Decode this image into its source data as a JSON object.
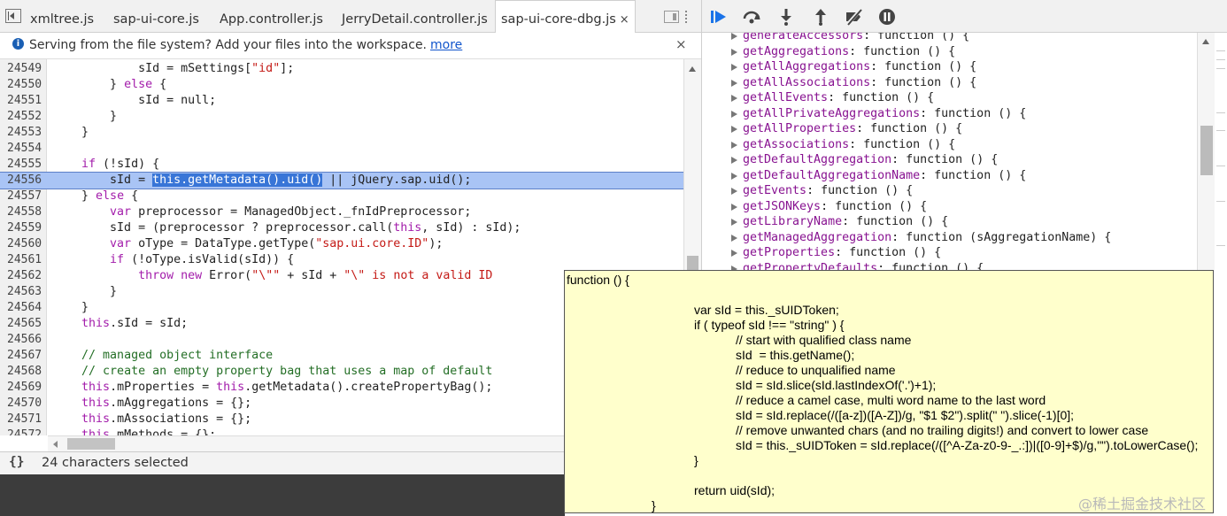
{
  "tabs": [
    {
      "label": "xmltree.js"
    },
    {
      "label": "sap-ui-core.js"
    },
    {
      "label": "App.controller.js"
    },
    {
      "label": "JerryDetail.controller.js"
    },
    {
      "label": "sap-ui-core-dbg.js",
      "active": true,
      "close": "×"
    }
  ],
  "infobar": {
    "message": "Serving from the file system? Add your files into the workspace.",
    "link": "more",
    "close": "×"
  },
  "editor": {
    "lines": [
      {
        "n": "24549",
        "indent": "            ",
        "tokens": [
          [
            "",
            "sId = mSettings["
          ],
          [
            "str",
            "\"id\""
          ],
          [
            "",
            "];"
          ]
        ]
      },
      {
        "n": "24550",
        "indent": "        ",
        "tokens": [
          [
            "",
            "} "
          ],
          [
            "kw",
            "else"
          ],
          [
            "",
            " {"
          ]
        ]
      },
      {
        "n": "24551",
        "indent": "            ",
        "tokens": [
          [
            "",
            "sId = null;"
          ]
        ]
      },
      {
        "n": "24552",
        "indent": "        ",
        "tokens": [
          [
            "",
            "}"
          ]
        ]
      },
      {
        "n": "24553",
        "indent": "    ",
        "tokens": [
          [
            "",
            "}"
          ]
        ]
      },
      {
        "n": "24554",
        "indent": "",
        "tokens": []
      },
      {
        "n": "24555",
        "indent": "    ",
        "tokens": [
          [
            "kw",
            "if"
          ],
          [
            "",
            " (!sId) {"
          ]
        ]
      },
      {
        "n": "24556",
        "indent": "        ",
        "highlight": true,
        "tokens": [
          [
            "",
            "sId = "
          ],
          [
            "sel",
            "this.getMetadata().uid()"
          ],
          [
            "",
            " || jQuery.sap.uid();"
          ]
        ]
      },
      {
        "n": "24557",
        "indent": "    ",
        "tokens": [
          [
            "",
            "} "
          ],
          [
            "kw",
            "else"
          ],
          [
            "",
            " {"
          ]
        ]
      },
      {
        "n": "24558",
        "indent": "        ",
        "tokens": [
          [
            "kw",
            "var"
          ],
          [
            "",
            " preprocessor = ManagedObject._fnIdPreprocessor;"
          ]
        ]
      },
      {
        "n": "24559",
        "indent": "        ",
        "tokens": [
          [
            "",
            "sId = (preprocessor ? preprocessor.call("
          ],
          [
            "kw",
            "this"
          ],
          [
            "",
            ", sId) : sId);"
          ]
        ]
      },
      {
        "n": "24560",
        "indent": "        ",
        "tokens": [
          [
            "kw",
            "var"
          ],
          [
            "",
            " oType = DataType.getType("
          ],
          [
            "str",
            "\"sap.ui.core.ID\""
          ],
          [
            "",
            ");"
          ]
        ]
      },
      {
        "n": "24561",
        "indent": "        ",
        "tokens": [
          [
            "kw",
            "if"
          ],
          [
            "",
            " (!oType.isValid(sId)) {"
          ]
        ]
      },
      {
        "n": "24562",
        "indent": "            ",
        "tokens": [
          [
            "kw",
            "throw new"
          ],
          [
            "",
            " Error("
          ],
          [
            "str",
            "\"\\\"\""
          ],
          [
            "",
            " + sId + "
          ],
          [
            "str",
            "\"\\\" is not a valid ID"
          ]
        ]
      },
      {
        "n": "24563",
        "indent": "        ",
        "tokens": [
          [
            "",
            "}"
          ]
        ]
      },
      {
        "n": "24564",
        "indent": "    ",
        "tokens": [
          [
            "",
            "}"
          ]
        ]
      },
      {
        "n": "24565",
        "indent": "    ",
        "tokens": [
          [
            "kw",
            "this"
          ],
          [
            "",
            ".sId = sId;"
          ]
        ]
      },
      {
        "n": "24566",
        "indent": "",
        "tokens": []
      },
      {
        "n": "24567",
        "indent": "    ",
        "tokens": [
          [
            "cmt",
            "// managed object interface"
          ]
        ]
      },
      {
        "n": "24568",
        "indent": "    ",
        "tokens": [
          [
            "cmt",
            "// create an empty property bag that uses a map of default"
          ]
        ]
      },
      {
        "n": "24569",
        "indent": "    ",
        "tokens": [
          [
            "kw",
            "this"
          ],
          [
            "",
            ".mProperties = "
          ],
          [
            "kw",
            "this"
          ],
          [
            "",
            ".getMetadata().createPropertyBag();"
          ]
        ]
      },
      {
        "n": "24570",
        "indent": "    ",
        "tokens": [
          [
            "kw",
            "this"
          ],
          [
            "",
            ".mAggregations = {};"
          ]
        ]
      },
      {
        "n": "24571",
        "indent": "    ",
        "tokens": [
          [
            "kw",
            "this"
          ],
          [
            "",
            ".mAssociations = {};"
          ]
        ]
      },
      {
        "n": "24572",
        "indent": "    ",
        "tokens": [
          [
            "kw",
            "this"
          ],
          [
            "",
            ".mMethods = {};"
          ]
        ]
      }
    ]
  },
  "statusbar": {
    "braces": "{}",
    "text": "24 characters selected"
  },
  "scope": {
    "items": [
      {
        "name": "generateAccessors",
        "value": ": function () {"
      },
      {
        "name": "getAggregations",
        "value": ": function () {"
      },
      {
        "name": "getAllAggregations",
        "value": ": function () {"
      },
      {
        "name": "getAllAssociations",
        "value": ": function () {"
      },
      {
        "name": "getAllEvents",
        "value": ": function () {"
      },
      {
        "name": "getAllPrivateAggregations",
        "value": ": function () {"
      },
      {
        "name": "getAllProperties",
        "value": ": function () {"
      },
      {
        "name": "getAssociations",
        "value": ": function () {"
      },
      {
        "name": "getDefaultAggregation",
        "value": ": function () {"
      },
      {
        "name": "getDefaultAggregationName",
        "value": ": function () {"
      },
      {
        "name": "getEvents",
        "value": ": function () {"
      },
      {
        "name": "getJSONKeys",
        "value": ": function () {"
      },
      {
        "name": "getLibraryName",
        "value": ": function () {"
      },
      {
        "name": "getManagedAggregation",
        "value": ": function (sAggregationName) {"
      },
      {
        "name": "getProperties",
        "value": ": function () {"
      },
      {
        "name": "getPropertyDefaults",
        "value": ": function () {"
      }
    ]
  },
  "popover": {
    "lines": [
      {
        "level": 0,
        "text": "function () {"
      },
      {
        "level": -1,
        "text": ""
      },
      {
        "level": 1,
        "text": "var sId = this._sUIDToken;"
      },
      {
        "level": 1,
        "text": "if ( typeof sId !== \"string\" ) {"
      },
      {
        "level": 2,
        "text": "// start with qualified class name"
      },
      {
        "level": 2,
        "text": "sId  = this.getName();"
      },
      {
        "level": 2,
        "text": "// reduce to unqualified name"
      },
      {
        "level": 2,
        "text": "sId = sId.slice(sId.lastIndexOf('.')+1);"
      },
      {
        "level": 2,
        "text": "// reduce a camel case, multi word name to the last word"
      },
      {
        "level": 2,
        "text": "sId = sId.replace(/([a-z])([A-Z])/g, \"$1 $2\").split(\" \").slice(-1)[0];"
      },
      {
        "level": 2,
        "text": "// remove unwanted chars (and no trailing digits!) and convert to lower case"
      },
      {
        "level": 2,
        "text": "sId = this._sUIDToken = sId.replace(/([^A-Za-z0-9-_.:])|([0-9]+$)/g,\"\").toLowerCase();"
      },
      {
        "level": 1,
        "text": "}"
      },
      {
        "level": -1,
        "text": ""
      },
      {
        "level": 1,
        "text": "return uid(sId);"
      },
      {
        "level": 3,
        "text": "}"
      }
    ]
  },
  "watermark": "@稀土掘金技术社区"
}
